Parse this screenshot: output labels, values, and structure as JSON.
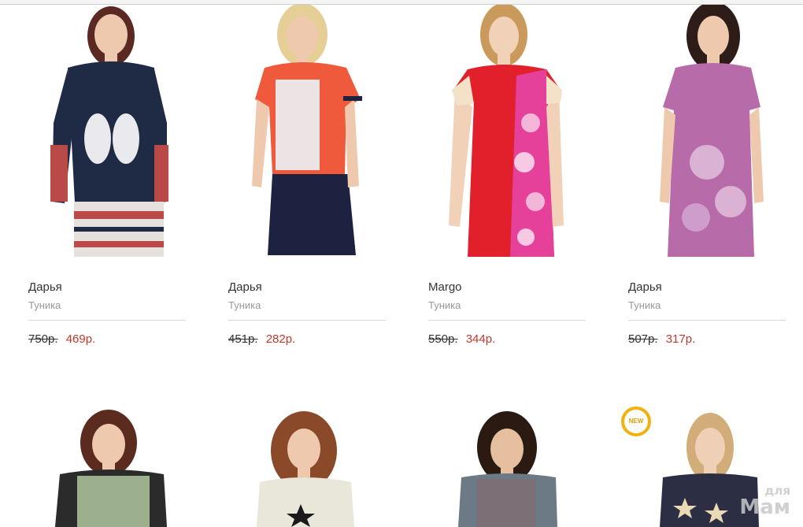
{
  "products": [
    {
      "brand": "Дарья",
      "type": "Туника",
      "old_price": "750р.",
      "new_price": "469р."
    },
    {
      "brand": "Дарья",
      "type": "Туника",
      "old_price": "451р.",
      "new_price": "282р."
    },
    {
      "brand": "Margo",
      "type": "Туника",
      "old_price": "550р.",
      "new_price": "344р."
    },
    {
      "brand": "Дарья",
      "type": "Туника",
      "old_price": "507р.",
      "new_price": "317р."
    }
  ],
  "badge": {
    "label": "NEW"
  },
  "watermark": {
    "line1": "для",
    "line2": "Мам"
  },
  "colors": {
    "accent_price": "#c0392b",
    "badge_ring": "#f2b10e"
  }
}
